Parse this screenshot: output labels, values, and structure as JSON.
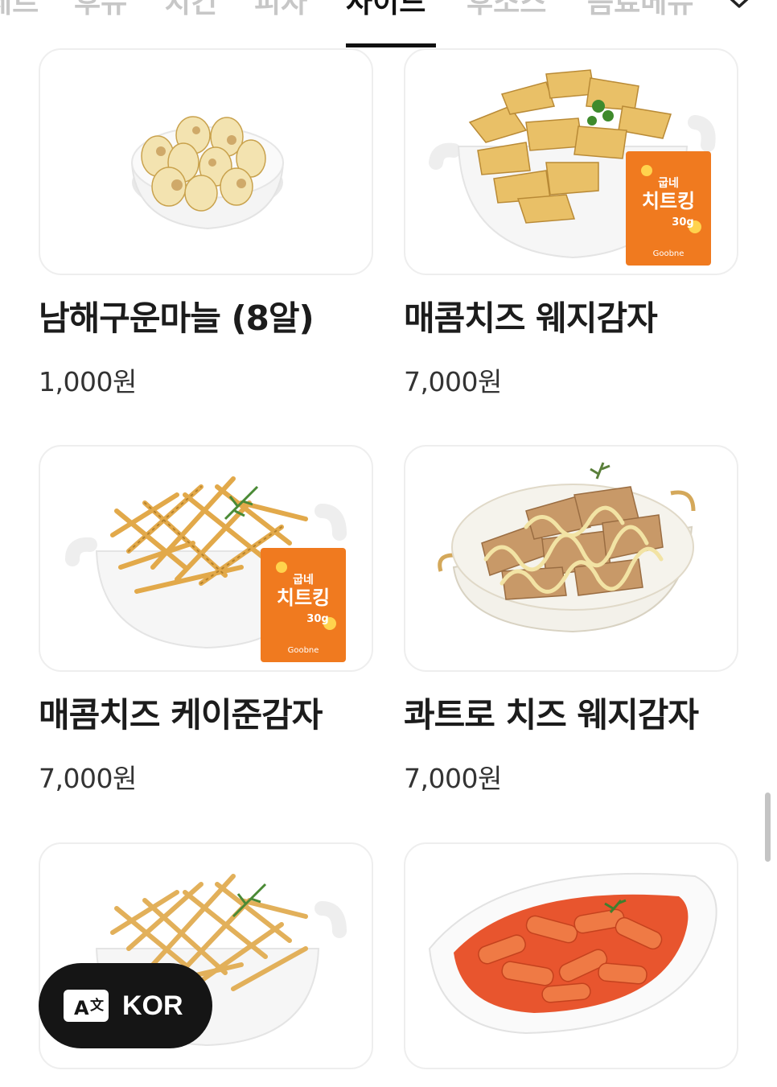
{
  "tabs": [
    {
      "label": "세트",
      "active": false
    },
    {
      "label": "후뉴",
      "active": false
    },
    {
      "label": "치킨",
      "active": false
    },
    {
      "label": "피자",
      "active": false
    },
    {
      "label": "사이드",
      "active": true
    },
    {
      "label": "후소스",
      "active": false
    },
    {
      "label": "음료메뉴",
      "active": false
    }
  ],
  "menu": [
    {
      "name": "남해구운마늘 (8알)",
      "price": "1,000원",
      "image": "roasted-garlic"
    },
    {
      "name": "매콤치즈 웨지감자",
      "price": "7,000원",
      "image": "wedge-potato-with-cheese-packet"
    },
    {
      "name": "매콤치즈 케이준감자",
      "price": "7,000원",
      "image": "cajun-fries-with-cheese-packet"
    },
    {
      "name": "콰트로 치즈 웨지감자",
      "price": "7,000원",
      "image": "quattro-cheese-wedges"
    },
    {
      "name": "",
      "price": "",
      "image": "fries"
    },
    {
      "name": "",
      "price": "",
      "image": "tteokbokki"
    }
  ],
  "packet": {
    "brand": "Goobne",
    "title": "치트킹",
    "weight": "30g",
    "tag": "굽네"
  },
  "language_button": {
    "label": "KOR",
    "icon": "translate-icon"
  },
  "colors": {
    "active_tab": "#111111",
    "inactive_tab": "#c7c7c7",
    "card_border": "#eeeeee",
    "button_bg": "#151515"
  }
}
